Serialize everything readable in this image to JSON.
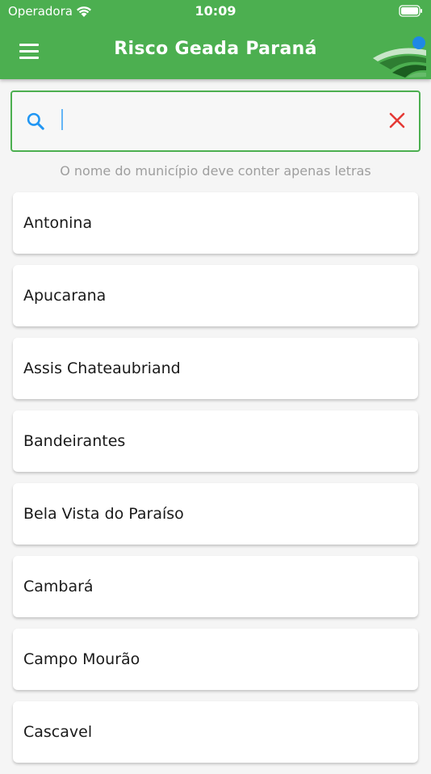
{
  "status_bar": {
    "carrier": "Operadora",
    "time": "10:09"
  },
  "app_bar": {
    "title": "Risco Geada Paraná"
  },
  "search": {
    "value": "",
    "placeholder": "",
    "hint": "O nome do município deve conter apenas letras"
  },
  "colors": {
    "primary": "#4caf50",
    "search_icon": "#2196f3",
    "clear_icon": "#e53935"
  },
  "icons": [
    "menu-icon",
    "logo",
    "search-icon",
    "clear-icon",
    "wifi-icon",
    "battery-icon"
  ],
  "municipalities": [
    "Antonina",
    "Apucarana",
    "Assis Chateaubriand",
    "Bandeirantes",
    "Bela Vista do Paraíso",
    "Cambará",
    "Campo Mourão",
    "Cascavel"
  ]
}
